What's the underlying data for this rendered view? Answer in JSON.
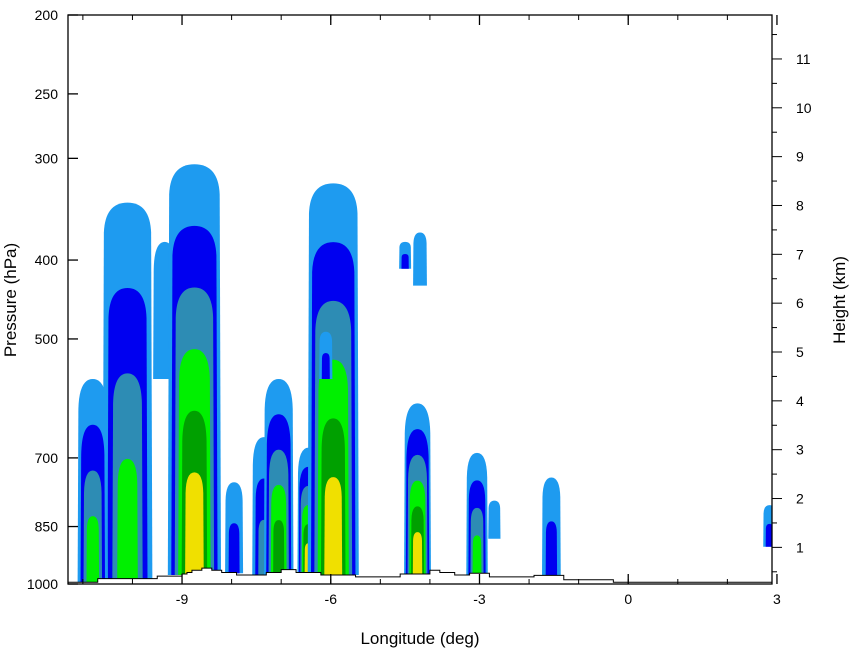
{
  "chart_data": {
    "type": "heatmap",
    "subtype": "filled-contour vertical cross-section",
    "xlabel": "Longitude (deg)",
    "ylabel_left": "Pressure (hPa)",
    "ylabel_right": "Height (km)",
    "x_range": [
      -11.3,
      2.9
    ],
    "pressure_range_hPa": [
      1000,
      200
    ],
    "y_left_scale": "log",
    "height_range_km": [
      0.25,
      11.9
    ],
    "x_ticks": [
      -9,
      -6,
      -3,
      0,
      3
    ],
    "x_tick_labels": [
      "-9",
      "-6",
      "-3",
      "0",
      "3"
    ],
    "y_left_ticks": [
      1000,
      850,
      700,
      500,
      400,
      300,
      250,
      200
    ],
    "y_left_tick_labels": [
      "1000",
      "850",
      "700",
      "500",
      "400",
      "300",
      "250",
      "200"
    ],
    "y_right_ticks": [
      1,
      2,
      3,
      4,
      5,
      6,
      7,
      8,
      9,
      10,
      11
    ],
    "y_right_tick_labels": [
      "1",
      "2",
      "3",
      "4",
      "5",
      "6",
      "7",
      "8",
      "9",
      "10",
      "11"
    ],
    "grid": false,
    "legend": "none",
    "level_colors": [
      "#1e9bf0",
      "#0000f0",
      "#2d8cb4",
      "#00f000",
      "#00a000",
      "#f0e000"
    ],
    "terrain_profile": {
      "lon": [
        -11.3,
        -10.7,
        -10.7,
        -9.5,
        -9.5,
        -9.0,
        -9.0,
        -8.9,
        -8.9,
        -8.8,
        -8.8,
        -8.6,
        -8.6,
        -8.4,
        -8.4,
        -8.2,
        -8.2,
        -7.9,
        -7.9,
        -7.3,
        -7.3,
        -7.0,
        -7.0,
        -6.7,
        -6.7,
        -6.2,
        -6.2,
        -5.5,
        -5.5,
        -4.6,
        -4.6,
        -4.0,
        -4.0,
        -3.8,
        -3.8,
        -3.5,
        -3.5,
        -3.2,
        -3.2,
        -2.8,
        -2.8,
        -1.9,
        -1.9,
        -1.3,
        -1.3,
        -0.3,
        -0.3,
        2.9
      ],
      "pressure_hPa": [
        995,
        995,
        985,
        985,
        978,
        978,
        972,
        972,
        968,
        968,
        962,
        962,
        956,
        956,
        962,
        962,
        968,
        968,
        975,
        975,
        968,
        968,
        960,
        960,
        968,
        968,
        975,
        975,
        980,
        980,
        972,
        972,
        962,
        962,
        968,
        968,
        975,
        975,
        970,
        970,
        980,
        980,
        976,
        976,
        988,
        988,
        995,
        995
      ]
    },
    "cells": [
      {
        "lon": -10.1,
        "top_hPa": 340,
        "bottom_hPa": 995,
        "peak_level": 3
      },
      {
        "lon": -10.8,
        "top_hPa": 560,
        "bottom_hPa": 995,
        "peak_level": 3
      },
      {
        "lon": -9.35,
        "top_hPa": 380,
        "bottom_hPa": 560,
        "peak_level": 0
      },
      {
        "lon": -8.75,
        "top_hPa": 305,
        "bottom_hPa": 975,
        "peak_level": 5
      },
      {
        "lon": -7.95,
        "top_hPa": 750,
        "bottom_hPa": 970,
        "peak_level": 1
      },
      {
        "lon": -7.35,
        "top_hPa": 660,
        "bottom_hPa": 975,
        "peak_level": 2
      },
      {
        "lon": -7.05,
        "top_hPa": 560,
        "bottom_hPa": 975,
        "peak_level": 4
      },
      {
        "lon": -6.45,
        "top_hPa": 680,
        "bottom_hPa": 975,
        "peak_level": 5
      },
      {
        "lon": -5.95,
        "top_hPa": 322,
        "bottom_hPa": 975,
        "peak_level": 5
      },
      {
        "lon": -6.1,
        "top_hPa": 490,
        "bottom_hPa": 560,
        "peak_level": 1
      },
      {
        "lon": -4.5,
        "top_hPa": 380,
        "bottom_hPa": 410,
        "peak_level": 1
      },
      {
        "lon": -4.2,
        "top_hPa": 370,
        "bottom_hPa": 430,
        "peak_level": 0
      },
      {
        "lon": -4.25,
        "top_hPa": 600,
        "bottom_hPa": 975,
        "peak_level": 5
      },
      {
        "lon": -3.05,
        "top_hPa": 690,
        "bottom_hPa": 975,
        "peak_level": 3
      },
      {
        "lon": -2.7,
        "top_hPa": 790,
        "bottom_hPa": 880,
        "peak_level": 0
      },
      {
        "lon": -1.55,
        "top_hPa": 740,
        "bottom_hPa": 975,
        "peak_level": 1
      },
      {
        "lon": 2.85,
        "top_hPa": 800,
        "bottom_hPa": 900,
        "peak_level": 1
      }
    ]
  }
}
